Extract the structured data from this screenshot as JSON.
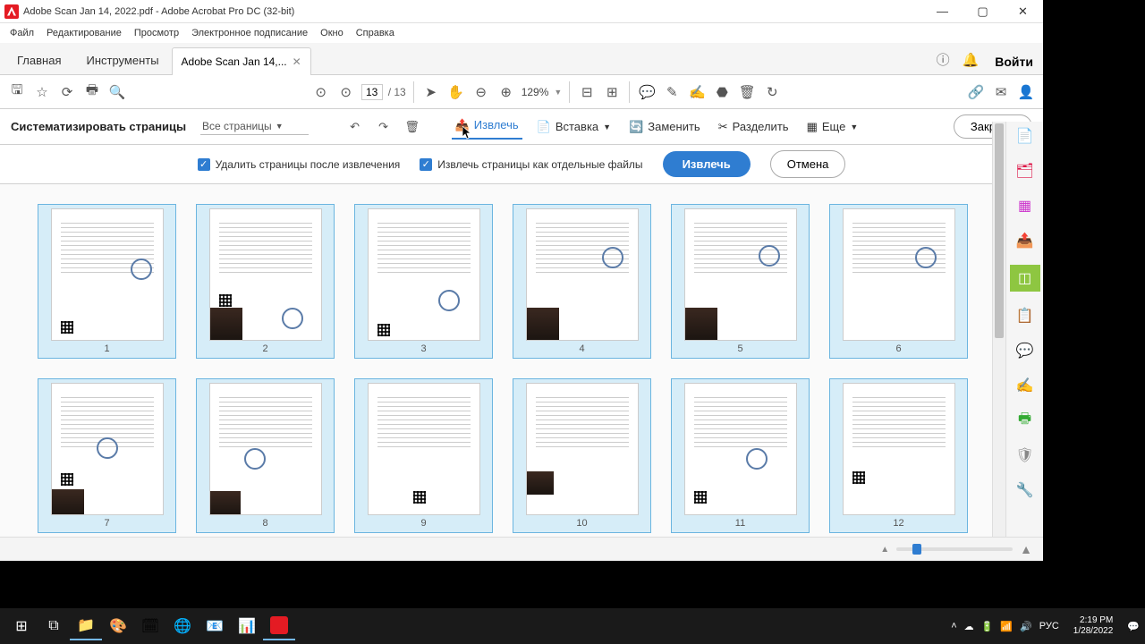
{
  "window": {
    "title": "Adobe Scan Jan 14, 2022.pdf - Adobe Acrobat Pro DC (32-bit)"
  },
  "menu": [
    "Файл",
    "Редактирование",
    "Просмотр",
    "Электронное подписание",
    "Окно",
    "Справка"
  ],
  "tabs": {
    "home": "Главная",
    "tools": "Инструменты",
    "doc": "Adobe Scan Jan 14,...",
    "signin": "Войти"
  },
  "toolbar": {
    "page_current": "13",
    "page_total": "/  13",
    "zoom": "129%"
  },
  "actionbar": {
    "title": "Систематизировать страницы",
    "dropdown": "Все страницы",
    "extract": "Извлечь",
    "insert": "Вставка",
    "replace": "Заменить",
    "split": "Разделить",
    "more": "Еще",
    "close": "Закрыть"
  },
  "options": {
    "delete_after": "Удалить страницы после извлечения",
    "separate_files": "Извлечь страницы как отдельные файлы",
    "extract_btn": "Извлечь",
    "cancel_btn": "Отмена"
  },
  "thumbs": {
    "count": 13,
    "labels": [
      "1",
      "2",
      "3",
      "4",
      "5",
      "6",
      "7",
      "8",
      "9",
      "10",
      "11",
      "12"
    ]
  },
  "taskbar": {
    "lang": "РУС",
    "time": "2:19 PM",
    "date": "1/28/2022"
  }
}
